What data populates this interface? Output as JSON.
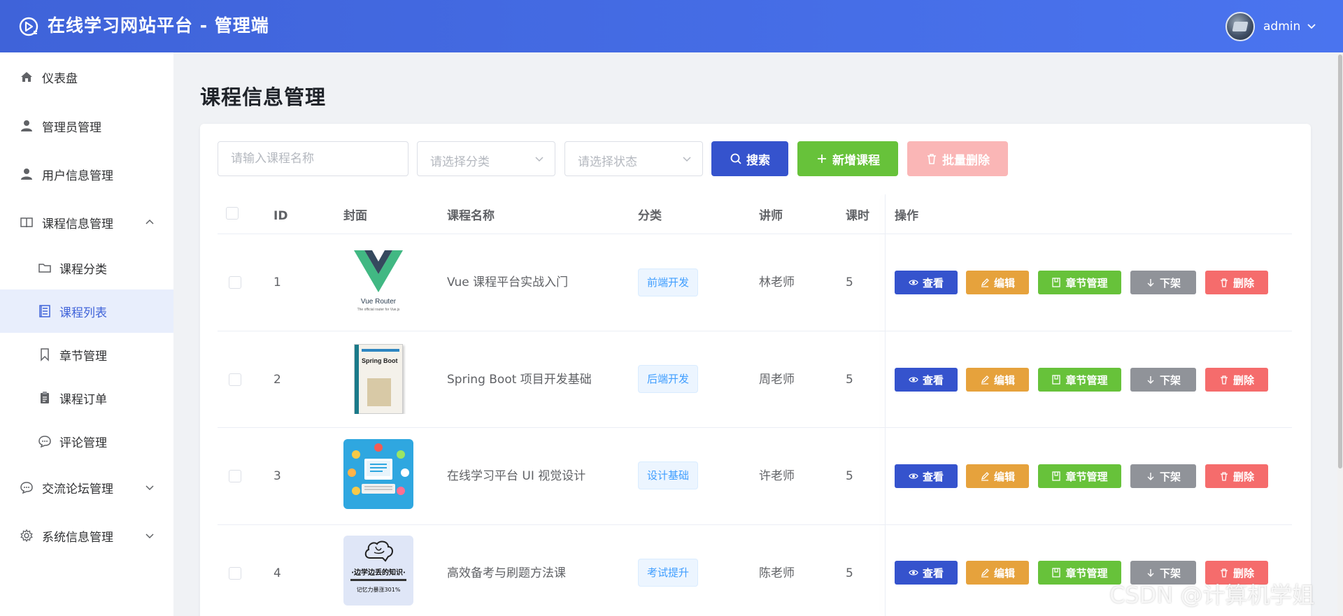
{
  "header": {
    "title": "在线学习网站平台 - 管理端",
    "user": "admin"
  },
  "sidebar": {
    "items": [
      {
        "label": "仪表盘",
        "icon": "home-icon"
      },
      {
        "label": "管理员管理",
        "icon": "user-icon"
      },
      {
        "label": "用户信息管理",
        "icon": "user-icon"
      },
      {
        "label": "课程信息管理",
        "icon": "book-icon",
        "expanded": true
      },
      {
        "label": "交流论坛管理",
        "icon": "chat-icon",
        "expanded": false
      },
      {
        "label": "系统信息管理",
        "icon": "gear-icon",
        "expanded": false
      }
    ],
    "subitems": [
      {
        "label": "课程分类",
        "icon": "folder-icon"
      },
      {
        "label": "课程列表",
        "icon": "list-icon",
        "active": true
      },
      {
        "label": "章节管理",
        "icon": "bookmark-icon"
      },
      {
        "label": "课程订单",
        "icon": "clipboard-icon"
      },
      {
        "label": "评论管理",
        "icon": "comment-icon"
      }
    ]
  },
  "page": {
    "title": "课程信息管理"
  },
  "filters": {
    "name_placeholder": "请输入课程名称",
    "category_placeholder": "请选择分类",
    "status_placeholder": "请选择状态"
  },
  "toolbar": {
    "search": "搜索",
    "add": "新增课程",
    "batch_delete": "批量删除"
  },
  "table": {
    "columns": [
      "ID",
      "封面",
      "课程名称",
      "分类",
      "讲师",
      "课时",
      "操作"
    ],
    "rows": [
      {
        "id": "1",
        "name": "Vue 课程平台实战入门",
        "category": "前端开发",
        "teacher": "林老师",
        "hours": "5",
        "cover_text": "Vue Router",
        "cover_subtext": "The official router for Vue.js"
      },
      {
        "id": "2",
        "name": "Spring Boot 项目开发基础",
        "category": "后端开发",
        "teacher": "周老师",
        "hours": "5",
        "cover_text": "Spring Boot"
      },
      {
        "id": "3",
        "name": "在线学习平台 UI 视觉设计",
        "category": "设计基础",
        "teacher": "许老师",
        "hours": "5"
      },
      {
        "id": "4",
        "name": "高效备考与刷题方法课",
        "category": "考试提升",
        "teacher": "陈老师",
        "hours": "5",
        "cover_text": "·边学边丢的知识·",
        "cover_subtext": "记忆力暴涨301%"
      }
    ],
    "actions": {
      "view": "查看",
      "edit": "编辑",
      "chapters": "章节管理",
      "offline": "下架",
      "delete": "删除"
    }
  },
  "watermark": "CSDN @计算机学姐",
  "colors": {
    "header": "#4a74ef",
    "primary": "#3553cd",
    "success": "#67c23a",
    "warning": "#e6a23c",
    "info": "#909399",
    "danger": "#f56c6c",
    "tag": "#409eff"
  }
}
